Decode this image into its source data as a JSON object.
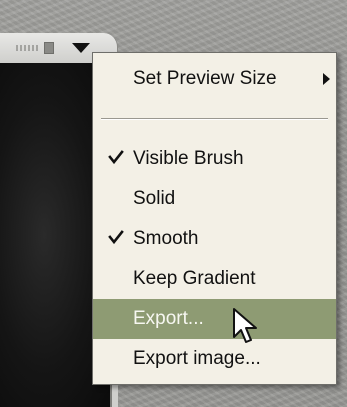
{
  "menu": {
    "items": [
      {
        "label": "Set Preview Size",
        "checked": false,
        "has_submenu": true,
        "highlighted": false
      },
      {
        "label": "Visible Brush",
        "checked": true,
        "has_submenu": false,
        "highlighted": false
      },
      {
        "label": "Solid",
        "checked": false,
        "has_submenu": false,
        "highlighted": false
      },
      {
        "label": "Smooth",
        "checked": true,
        "has_submenu": false,
        "highlighted": false
      },
      {
        "label": "Keep Gradient",
        "checked": false,
        "has_submenu": false,
        "highlighted": false
      },
      {
        "label": "Export...",
        "checked": false,
        "has_submenu": false,
        "highlighted": true
      },
      {
        "label": "Export image...",
        "checked": false,
        "has_submenu": false,
        "highlighted": false
      }
    ],
    "highlight_color": "#8e9b73",
    "background_color": "#f3f0e6"
  },
  "panel": {
    "menu_button_icon": "triangle-down-icon",
    "preview_background": "#111111"
  },
  "cursor_icon": "arrow-pointer-icon"
}
